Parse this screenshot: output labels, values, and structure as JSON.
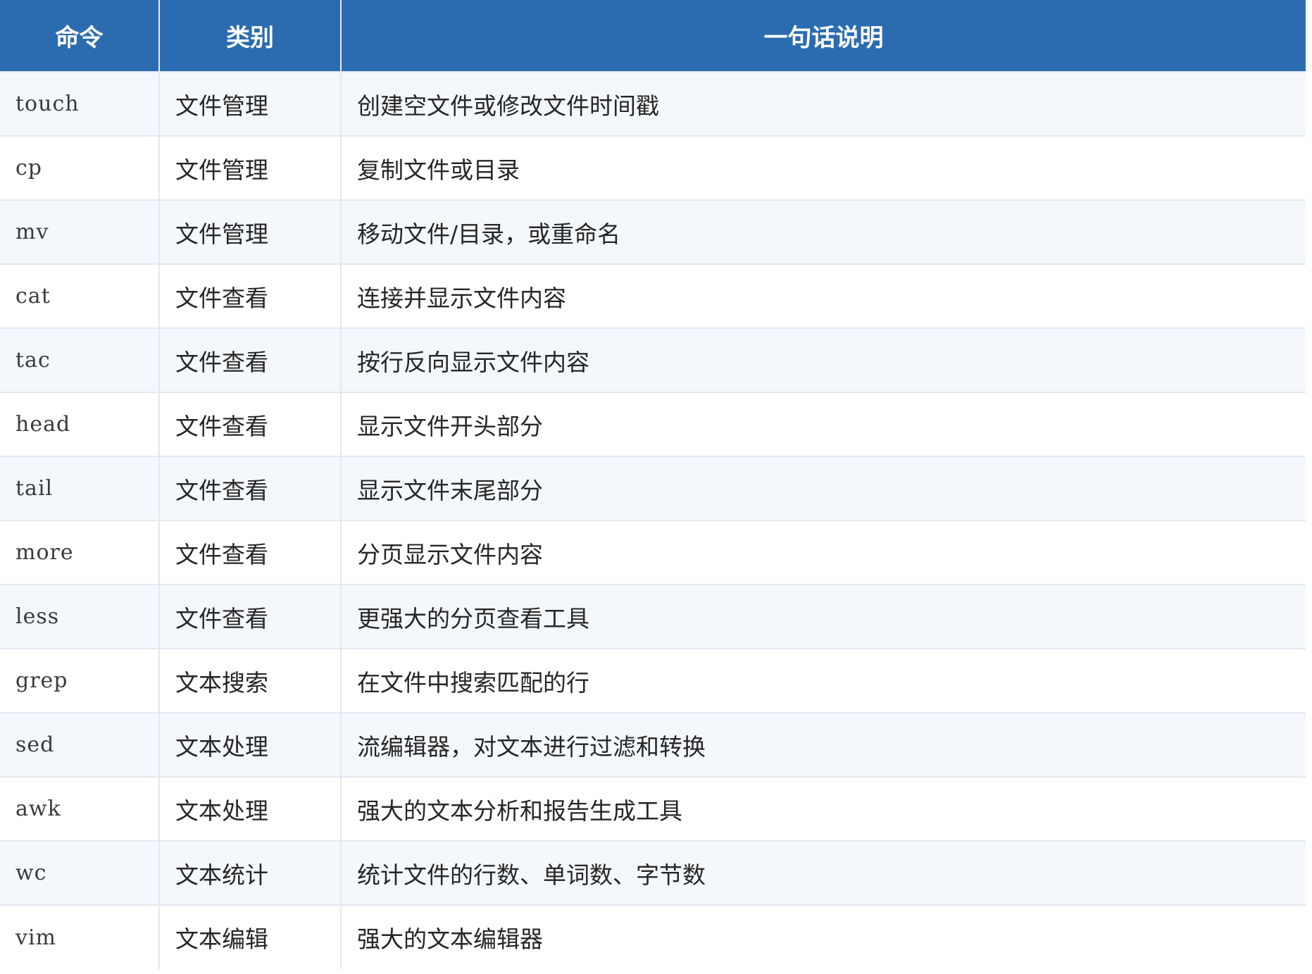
{
  "table": {
    "headers": [
      "命令",
      "类别",
      "一句话说明"
    ],
    "rows": [
      {
        "command": "touch",
        "category": "文件管理",
        "description": "创建空文件或修改文件时间戳"
      },
      {
        "command": "cp",
        "category": "文件管理",
        "description": "复制文件或目录"
      },
      {
        "command": "mv",
        "category": "文件管理",
        "description": "移动文件/目录，或重命名"
      },
      {
        "command": "cat",
        "category": "文件查看",
        "description": "连接并显示文件内容"
      },
      {
        "command": "tac",
        "category": "文件查看",
        "description": "按行反向显示文件内容"
      },
      {
        "command": "head",
        "category": "文件查看",
        "description": "显示文件开头部分"
      },
      {
        "command": "tail",
        "category": "文件查看",
        "description": "显示文件末尾部分"
      },
      {
        "command": "more",
        "category": "文件查看",
        "description": "分页显示文件内容"
      },
      {
        "command": "less",
        "category": "文件查看",
        "description": "更强大的分页查看工具"
      },
      {
        "command": "grep",
        "category": "文本搜索",
        "description": "在文件中搜索匹配的行"
      },
      {
        "command": "sed",
        "category": "文本处理",
        "description": "流编辑器，对文本进行过滤和转换"
      },
      {
        "command": "awk",
        "category": "文本处理",
        "description": "强大的文本分析和报告生成工具"
      },
      {
        "command": "wc",
        "category": "文本统计",
        "description": "统计文件的行数、单词数、字节数"
      },
      {
        "command": "vim",
        "category": "文本编辑",
        "description": "强大的文本编辑器"
      }
    ]
  },
  "colors": {
    "header_bg": "#2b6cb0",
    "header_text": "#ffffff",
    "row_alt_bg": "#f4f8fc",
    "row_bg": "#ffffff",
    "border": "#e3e8ee"
  }
}
